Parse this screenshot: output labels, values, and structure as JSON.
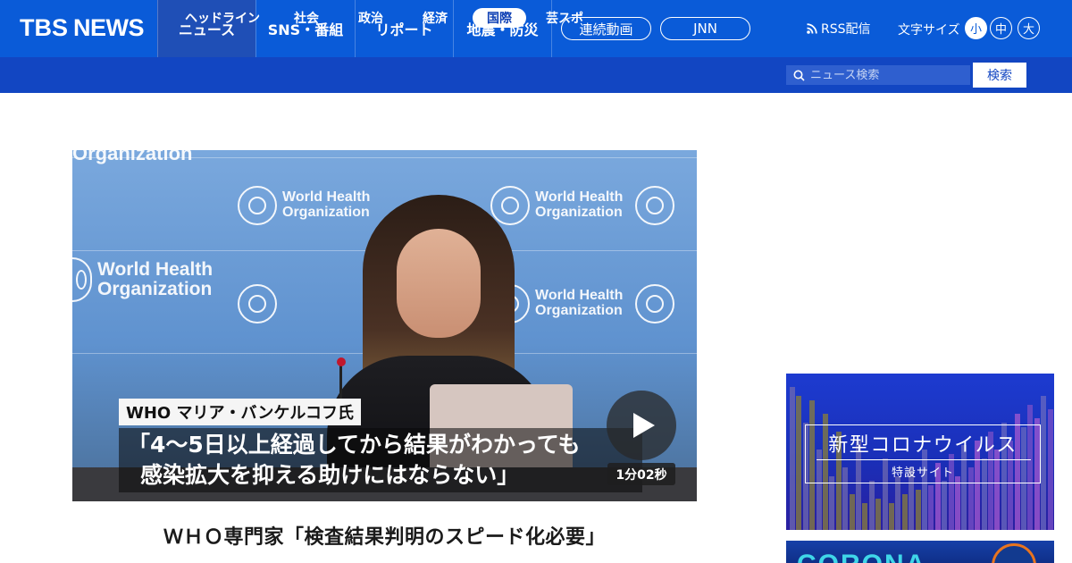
{
  "brand": {
    "logo_tbs": "TBS",
    "logo_news": "NEWS"
  },
  "main_nav": [
    {
      "label": "ニュース",
      "active": true
    },
    {
      "label": "SNS・番組",
      "active": false
    },
    {
      "label": "リポート",
      "active": false
    },
    {
      "label": "地震・防災",
      "active": false
    }
  ],
  "pills": {
    "video": "連続動画",
    "jnn": "JNN"
  },
  "header_tools": {
    "rss": "RSS配信",
    "font_size_label": "文字サイズ",
    "font_sizes": [
      "小",
      "中",
      "大"
    ],
    "font_size_selected": "小"
  },
  "sub_nav": [
    {
      "label": "ヘッドライン",
      "active": false
    },
    {
      "label": "社会",
      "active": false
    },
    {
      "label": "政治",
      "active": false
    },
    {
      "label": "経済",
      "active": false
    },
    {
      "label": "国際",
      "active": true
    },
    {
      "label": "芸スポ",
      "active": false
    }
  ],
  "search": {
    "placeholder": "ニュース検索",
    "button": "検索"
  },
  "video": {
    "who_text_line1": "World Health",
    "who_text_line2": "Organization",
    "caption_name": "WHO マリア・バンケルコフ氏",
    "caption_line1": "「4～5日以上経過してから結果がわかっても",
    "caption_line2": "感染拡大を抑える助けにはならない」",
    "duration": "1分02秒"
  },
  "article": {
    "headline": "ＷＨＯ専門家「検査結果判明のスピード化必要」"
  },
  "banners": {
    "covid_title": "新型コロナウイルス",
    "covid_sub": "特設サイト",
    "corona_text": "CORONA"
  },
  "colors": {
    "brand_blue": "#0a5bd8",
    "subnav_blue": "#1246c2",
    "banner_blue": "#1d3bd0"
  }
}
